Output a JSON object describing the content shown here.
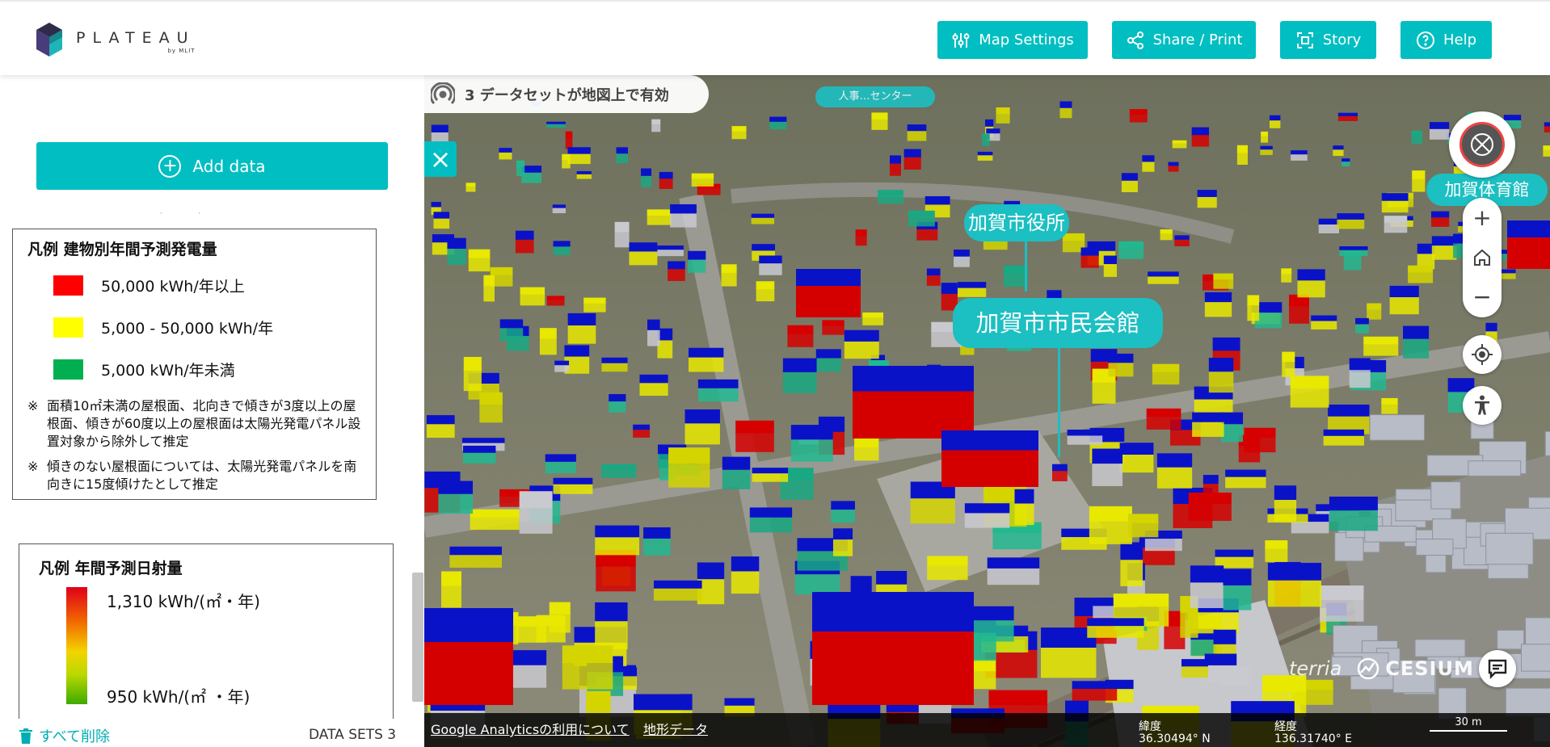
{
  "header": {
    "logo_name": "PLATEAU",
    "logo_sub": "by MLIT",
    "buttons": {
      "map_settings": "Map Settings",
      "share_print": "Share / Print",
      "story": "Story",
      "help": "Help"
    }
  },
  "left_panel": {
    "add_data": "Add data",
    "legend1": {
      "title": "凡例  建物別年間予測発電量",
      "items": [
        {
          "label": "50,000 kWh/年以上",
          "color": "#ff0000"
        },
        {
          "label": "5,000 - 50,000 kWh/年",
          "color": "#ffff00"
        },
        {
          "label": "5,000 kWh/年未満",
          "color": "#00b050"
        }
      ],
      "note_mark": "※",
      "note1": "面積10㎡未満の屋根面、北向きで傾きが3度以上の屋根面、傾きが60度以上の屋根面は太陽光発電パネル設置対象から除外して推定",
      "note2": "傾きのない屋根面については、太陽光発電パネルを南向きに15度傾けたとして推定"
    },
    "legend2": {
      "title": "凡例  年間予測日射量",
      "max_label": "1,310 kWh/(㎡・年)",
      "min_label": "950 kWh/(㎡ ・年)"
    },
    "delete_all": "すべて削除",
    "datasets_count": "DATA SETS 3"
  },
  "map": {
    "dataset_status": "3 データセットが地図上で有効",
    "poi_labels": {
      "city_hall": "加賀市役所",
      "civic_hall": "加賀市市民会館",
      "gym": "加賀体育館",
      "center": "人事…センター"
    },
    "credits": {
      "terria": "terria",
      "cesium": "CESIUM"
    },
    "bottom": {
      "analytics_link": "Google Analyticsの利用について",
      "terrain_link": "地形データ",
      "lat_label": "緯度",
      "lat_value": "36.30494° N",
      "lon_label": "経度",
      "lon_value": "136.31740° E",
      "scale": "30 m"
    }
  }
}
